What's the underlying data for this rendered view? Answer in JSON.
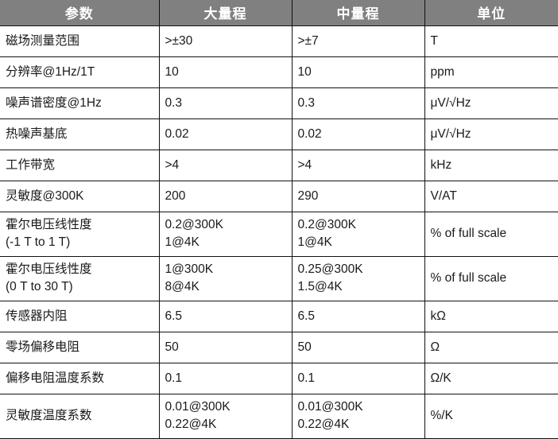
{
  "table": {
    "headers": [
      "参数",
      "大量程",
      "中量程",
      "单位"
    ],
    "colors": {
      "header_background": "#808080",
      "header_text": "#ffffff",
      "border": "#111111",
      "body_text": "#1a1a1a",
      "body_background": "#ffffff"
    },
    "rows": [
      {
        "lines": 1,
        "param": "磁场测量范围",
        "large_range": ">±30",
        "mid_range": ">±7",
        "unit": "T"
      },
      {
        "lines": 1,
        "param": "分辨率@1Hz/1T",
        "large_range": "10",
        "mid_range": "10",
        "unit": "ppm"
      },
      {
        "lines": 1,
        "param": "噪声谱密度@1Hz",
        "large_range": "0.3",
        "mid_range": "0.3",
        "unit": "μV/√Hz"
      },
      {
        "lines": 1,
        "param": "热噪声基底",
        "large_range": "0.02",
        "mid_range": "0.02",
        "unit": "μV/√Hz"
      },
      {
        "lines": 1,
        "param": "工作带宽",
        "large_range": ">4",
        "mid_range": ">4",
        "unit": "kHz"
      },
      {
        "lines": 1,
        "param": "灵敏度@300K",
        "large_range": "200",
        "mid_range": "290",
        "unit": "V/AT"
      },
      {
        "lines": 2,
        "param": "霍尔电压线性度\n(-1 T to 1 T)",
        "large_range": "0.2@300K\n1@4K",
        "mid_range": "0.2@300K\n1@4K",
        "unit": "% of full scale"
      },
      {
        "lines": 2,
        "param": "霍尔电压线性度\n(0 T to 30 T)",
        "large_range": "1@300K\n8@4K",
        "mid_range": "0.25@300K\n1.5@4K",
        "unit": "% of full scale"
      },
      {
        "lines": 1,
        "param": "传感器内阻",
        "large_range": "6.5",
        "mid_range": "6.5",
        "unit": "kΩ"
      },
      {
        "lines": 1,
        "param": "零场偏移电阻",
        "large_range": "50",
        "mid_range": "50",
        "unit": "Ω"
      },
      {
        "lines": 1,
        "param": "偏移电阻温度系数",
        "large_range": "0.1",
        "mid_range": "0.1",
        "unit": "Ω/K"
      },
      {
        "lines": 2,
        "param": "灵敏度温度系数",
        "large_range": "0.01@300K\n0.22@4K",
        "mid_range": "0.01@300K\n0.22@4K",
        "unit": "%/K"
      }
    ]
  }
}
